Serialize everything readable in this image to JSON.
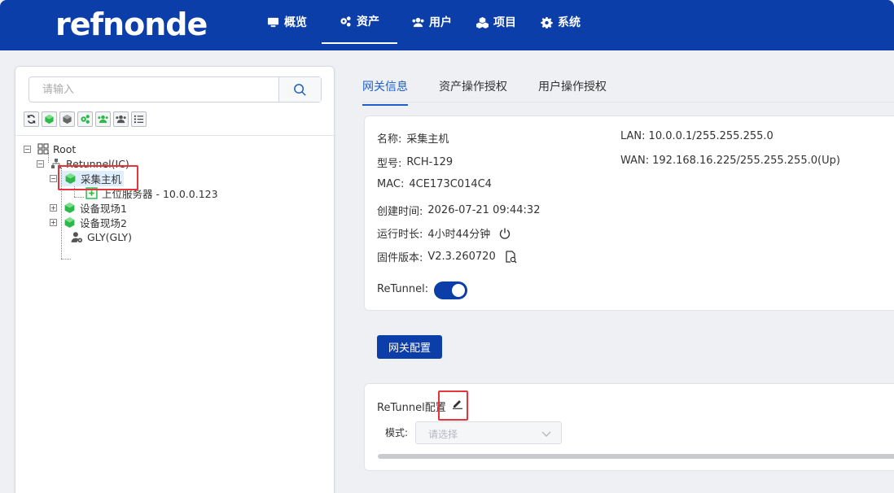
{
  "header": {
    "logo": "refnonde",
    "nav": [
      {
        "label": "概览",
        "icon": "monitor-icon"
      },
      {
        "label": "资产",
        "icon": "gears-icon"
      },
      {
        "label": "用户",
        "icon": "users-icon"
      },
      {
        "label": "项目",
        "icon": "cubes-icon"
      },
      {
        "label": "系统",
        "icon": "gear-icon"
      }
    ],
    "active_nav": "资产"
  },
  "sidebar": {
    "search_placeholder": "请输入",
    "toolbar_icons": [
      "refresh-icon",
      "add-green-cube-icon",
      "add-gray-cube-icon",
      "gear-green-icon",
      "users-green-icon",
      "users-gray-icon",
      "list-icon"
    ],
    "tree": [
      {
        "label": "Root",
        "icon": "grid-icon"
      },
      {
        "label": "Retunnel(IC)",
        "icon": "network-icon"
      },
      {
        "label": "采集主机",
        "icon": "green-cube-icon",
        "selected": true
      },
      {
        "label": "上位服务器 - 10.0.0.123",
        "icon": "server-green-icon"
      },
      {
        "label": "设备现场1",
        "icon": "green-cube-icon"
      },
      {
        "label": "设备现场2",
        "icon": "green-cube-icon"
      },
      {
        "label": "GLY(GLY)",
        "icon": "user-gear-icon"
      }
    ]
  },
  "tabs": [
    "网关信息",
    "资产操作授权",
    "用户操作授权"
  ],
  "active_tab": "网关信息",
  "info": {
    "name_k": "名称:",
    "name_v": "采集主机",
    "model_k": "型号:",
    "model_v": "RCH-129",
    "mac_k": "MAC:",
    "mac_v": "4CE173C014C4",
    "created_k": "创建时间:",
    "created_v": "2026-07-21 09:44:32",
    "uptime_k": "运行时长:",
    "uptime_v": "4小时44分钟",
    "firmware_k": "固件版本:",
    "firmware_v": "V2.3.260720",
    "lan_k": "LAN:",
    "lan_v": "10.0.0.1/255.255.255.0",
    "wan_k": "WAN:",
    "wan_v": "192.168.16.225/255.255.255.0(Up)",
    "retunnel_k": "ReTunnel:",
    "retunnel_enabled": true
  },
  "gateway_config_button": "网关配置",
  "retunnel_config": {
    "title": "ReTunnel配置",
    "mode_label": "模式:",
    "mode_placeholder": "请选择"
  },
  "colors": {
    "brand": "#0b3ea8",
    "active_tab": "#1f5fc7",
    "highlight": "#e5343a",
    "node_green": "#2fb84a"
  }
}
